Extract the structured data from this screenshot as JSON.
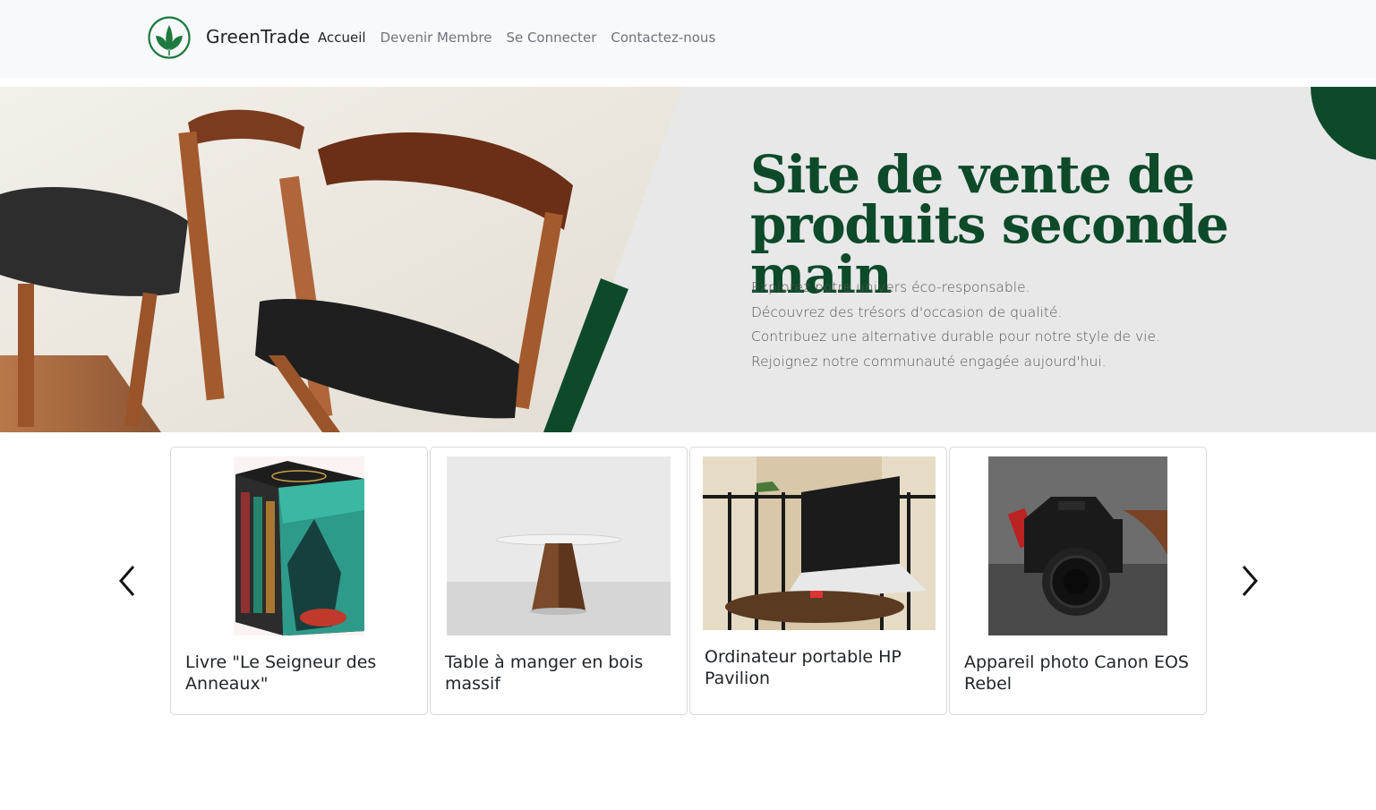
{
  "nav": {
    "brand": "GreenTrade",
    "links": [
      "Accueil",
      "Devenir Membre",
      "Se Connecter",
      "Contactez-nous"
    ]
  },
  "hero": {
    "title_line1": "Site de vente de",
    "title_line2": "produits seconde main",
    "lines": [
      "Explorez notre univers éco-responsable.",
      "Découvrez des trésors d'occasion de qualité.",
      "Contribuez une alternative durable pour notre style de vie.",
      "Rejoignez notre communauté engagée aujourd'hui."
    ]
  },
  "products": [
    {
      "title": "Livre \"Le Seigneur des Anneaux\"",
      "image": "book-box-set"
    },
    {
      "title": "Table à manger en bois massif",
      "image": "wooden-table"
    },
    {
      "title": "Ordinateur portable HP Pavilion",
      "image": "laptop"
    },
    {
      "title": "Appareil photo Canon EOS Rebel",
      "image": "camera"
    }
  ],
  "colors": {
    "brand_green": "#0d4a2a",
    "nav_bg": "#f8f9fa",
    "hero_bg": "#e8e8e8"
  }
}
